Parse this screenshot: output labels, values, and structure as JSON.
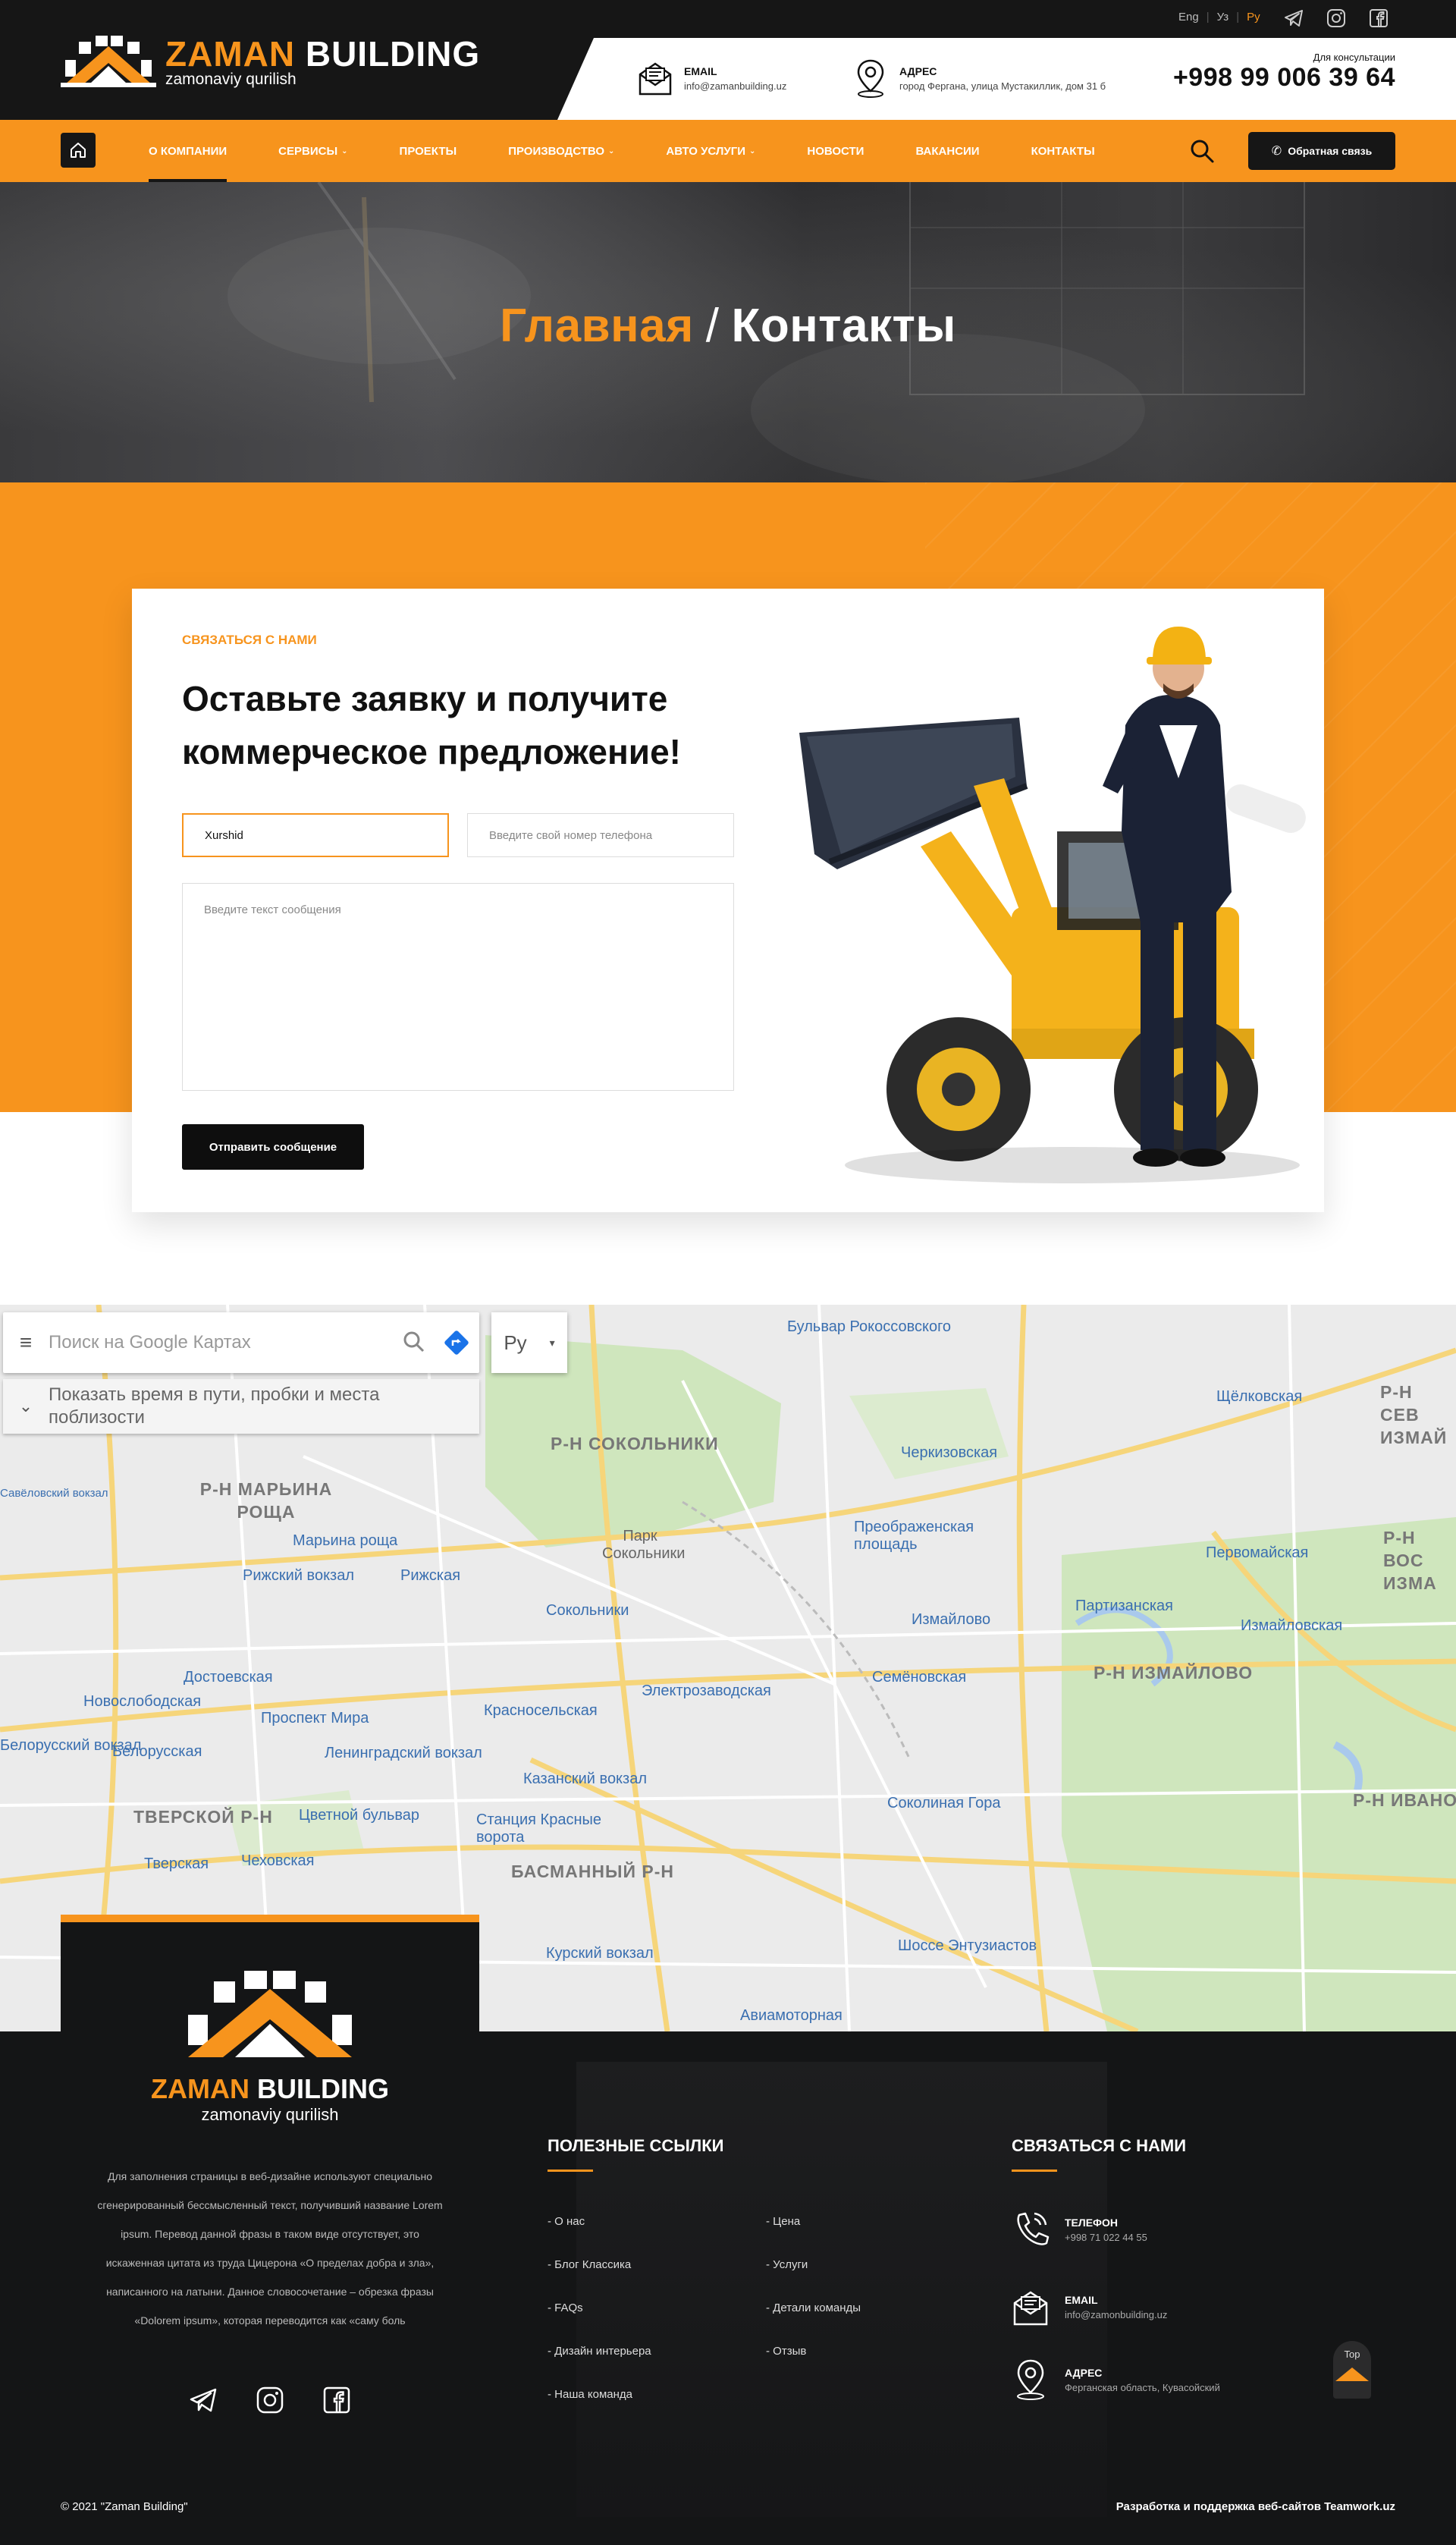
{
  "brand": {
    "name_orange": "ZAMAN",
    "name_white": "BUILDING",
    "tagline": "zamonaviy qurilish",
    "orange": "#f7941d",
    "dark": "#161616"
  },
  "header": {
    "languages": [
      "Eng",
      "Уз",
      "Ру"
    ],
    "active_language": "Ру",
    "social_icons": [
      "telegram-icon",
      "instagram-icon",
      "facebook-icon"
    ],
    "email": {
      "label": "EMAIL",
      "value": "info@zamanbuilding.uz",
      "icon": "envelope-icon"
    },
    "address": {
      "label": "АДРЕС",
      "value": "город Фергана, улица Мустакиллик, дом 31 б",
      "icon": "map-pin-icon"
    },
    "consult": {
      "label": "Для консультации",
      "phone": "+998 99 006 39 64"
    }
  },
  "nav": {
    "home_icon": "home-icon",
    "items": [
      {
        "label": "О КОМПАНИИ",
        "caret": ""
      },
      {
        "label": "СЕРВИСЫ",
        "caret": "⌄"
      },
      {
        "label": "ПРОЕКТЫ",
        "caret": ""
      },
      {
        "label": "ПРОИЗВОДСТВО",
        "caret": "⌄"
      },
      {
        "label": "АВТО УСЛУГИ",
        "caret": "⌄"
      },
      {
        "label": "НОВОСТИ",
        "caret": ""
      },
      {
        "label": "ВАКАНСИИ",
        "caret": ""
      },
      {
        "label": "КОНТАКТЫ",
        "caret": ""
      }
    ],
    "active_index": 0,
    "search_icon": "search-icon",
    "feedback_label": "Обратная связь"
  },
  "hero": {
    "crumb_home": "Главная",
    "separator": "/",
    "crumb_current": "Контакты"
  },
  "contact": {
    "kicker": "СВЯЗАТЬСЯ С НАМИ",
    "title": "Оставьте заявку и получите коммерческое предложение!",
    "name_value": "Xurshid",
    "phone_placeholder": "Введите свой номер телефона",
    "message_placeholder": "Введите текст сообщения",
    "submit_label": "Отправить сообщение"
  },
  "map": {
    "search_placeholder": "Поиск на Google Картах",
    "lang": "Ру",
    "hint": "Показать время в пути, пробки и места поблизости",
    "labels": {
      "l1": "Бульвар Рокоссовского",
      "l2": "Р-Н СОКОЛЬНИКИ",
      "l3": "Черкизовская",
      "l4": "Щёлковская",
      "l5": "Р-Н СЕВ ИЗМАЙ",
      "l6": "Р-Н МАРЬИНА РОЩА",
      "l7": "Марьина роща",
      "l8": "Парк Сокольники",
      "l9": "Преображенская площадь",
      "l10": "Первомайская",
      "l11": "Рижский вокзал",
      "l12": "Рижская",
      "l13": "Сокольники",
      "l14": "Партизанская",
      "l15": "Измайлово",
      "l16": "Измайловская",
      "l17": "Достоевская",
      "l18": "Новослободская",
      "l19": "Семёновская",
      "l20": "Р-Н ИЗМАЙЛОВО",
      "l21": "Проспект Мира",
      "l22": "Красносельская",
      "l23": "Электрозаводская",
      "l24": "Белорусская",
      "l25": "Ленинградский вокзал",
      "l26": "Казанский вокзал",
      "l27": "ТВЕРСКОЙ Р-Н",
      "l28": "Цветной бульвар",
      "l29": "Станция Красные ворота",
      "l30": "Соколиная Гора",
      "l31": "Тверская",
      "l32": "Чеховская",
      "l33": "БАСМАННЫЙ Р-Н",
      "l34": "Курский вокзал",
      "l35": "Шоссе Энтузиастов",
      "l36": "Авиамоторная",
      "l37": "Р-Н ИВАНО",
      "l38": "Белорусский вокзал",
      "l39": "Савёловский вокзал",
      "l40": "Р-Н ВОС ИЗМА"
    }
  },
  "footer": {
    "about": "Для заполнения страницы в веб-дизайне используют специально сгенерированный бессмысленный текст, получивший название Lorem ipsum. Перевод данной фразы в таком виде отсутствует, это искаженная цитата из труда Цицерона «О пределах добра и зла», написанного на латыни. Данное словосочетание – обрезка фразы «Dolorem ipsum», которая переводится как «саму боль",
    "links_title": "ПОЛЕЗНЫЕ ССЫЛКИ",
    "links_col1": [
      "- О нас",
      "- Блог Классика",
      "- FAQs",
      "- Дизайн интерьера",
      "- Наша команда"
    ],
    "links_col2": [
      "- Цена",
      "- Услуги",
      "- Детали команды",
      "- Отзыв"
    ],
    "contact_title": "СВЯЗАТЬСЯ С НАМИ",
    "phone": {
      "label": "ТЕЛЕФОН",
      "value": "+998 71 022 44 55",
      "icon": "phone-icon"
    },
    "email": {
      "label": "EMAIL",
      "value": "info@zamonbuilding.uz",
      "icon": "envelope-icon"
    },
    "address": {
      "label": "АДРЕС",
      "value": "Ферганская область, Кувасойский",
      "icon": "map-pin-icon"
    },
    "to_top": "Top",
    "copyright": "© 2021 \"Zaman Building\"",
    "developer": "Разработка и поддержка веб-сайтов Teamwork.uz"
  }
}
